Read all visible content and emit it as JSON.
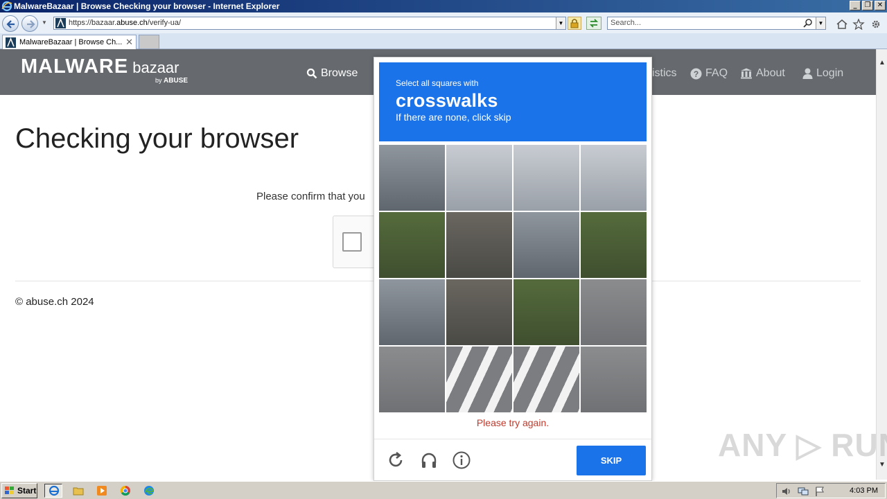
{
  "window": {
    "title": "MalwareBazaar | Browse Checking your browser - Internet Explorer",
    "minimize": "_",
    "restore": "❐",
    "close": "✕"
  },
  "address_bar": {
    "url_prefix": "https://bazaar.",
    "url_domain": "abuse.ch",
    "url_path": "/verify-ua/",
    "search_placeholder": "Search..."
  },
  "tabs": [
    {
      "label": "MalwareBazaar | Browse Ch...",
      "close": "✕"
    }
  ],
  "site": {
    "brand_main": "MALWARE",
    "brand_sub": "bazaar",
    "brand_by": "by",
    "brand_by_name": "ABUSE",
    "nav": {
      "browse": "Browse",
      "statistics": "istics",
      "faq": "FAQ",
      "about": "About",
      "login": "Login"
    }
  },
  "page": {
    "title": "Checking your browser",
    "confirm_text": "Please confirm that you",
    "copyright": "© abuse.ch 2024"
  },
  "captcha": {
    "prompt_line1": "Select all squares with",
    "prompt_target": "crosswalks",
    "prompt_line3": "If there are none, click skip",
    "error": "Please try again.",
    "skip_label": "SKIP"
  },
  "watermark": "ANY ▷ RUN",
  "taskbar": {
    "start_label": "Start",
    "clock": "4:03 PM"
  },
  "colors": {
    "captcha_blue": "#1a73e8",
    "header_gray": "#666a6e",
    "error_red": "#c0392b"
  }
}
